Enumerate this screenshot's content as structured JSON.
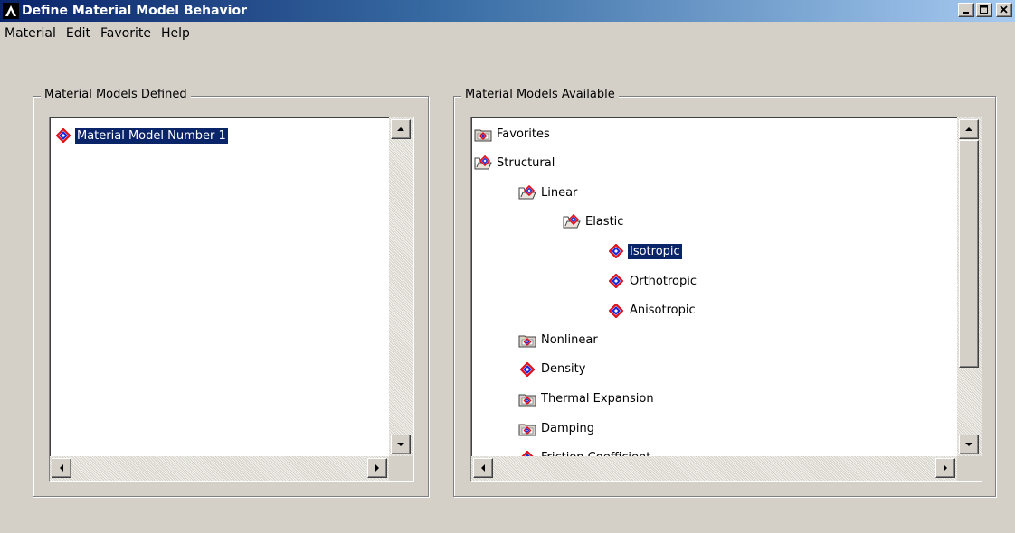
{
  "window": {
    "title": "Define Material Model Behavior",
    "controls": [
      "minimize-icon",
      "maximize-icon",
      "close-icon"
    ]
  },
  "menu": [
    "Material",
    "Edit",
    "Favorite",
    "Help"
  ],
  "defined_panel": {
    "title": "Material Models Defined",
    "items": [
      {
        "label": "Material Model Number 1",
        "icon": "material-model-icon",
        "selected": true
      }
    ]
  },
  "available_panel": {
    "title": "Material Models Available",
    "tree": [
      {
        "label": "Favorites",
        "icon": "closed-folder-icon",
        "level": 0
      },
      {
        "label": "Structural",
        "icon": "open-folder-icon",
        "level": 0
      },
      {
        "label": "Linear",
        "icon": "open-folder-icon",
        "level": 1
      },
      {
        "label": "Elastic",
        "icon": "open-folder-icon",
        "level": 2
      },
      {
        "label": "Isotropic",
        "icon": "material-model-icon",
        "level": 3,
        "selected": true
      },
      {
        "label": "Orthotropic",
        "icon": "material-model-icon",
        "level": 3
      },
      {
        "label": "Anisotropic",
        "icon": "material-model-icon",
        "level": 3
      },
      {
        "label": "Nonlinear",
        "icon": "closed-folder-icon",
        "level": 1
      },
      {
        "label": "Density",
        "icon": "material-model-icon",
        "level": 1
      },
      {
        "label": "Thermal Expansion",
        "icon": "closed-folder-icon",
        "level": 1
      },
      {
        "label": "Damping",
        "icon": "closed-folder-icon",
        "level": 1
      },
      {
        "label": "Friction Coefficient",
        "icon": "material-model-icon",
        "level": 1
      }
    ]
  },
  "colors": {
    "window_bg": "#d4d0c8",
    "titlebar_start": "#0a246a",
    "titlebar_end": "#a6caf0",
    "selection_bg": "#0a246a",
    "model_icon_red": "#e0101a",
    "model_icon_blue": "#1a2ad8"
  }
}
